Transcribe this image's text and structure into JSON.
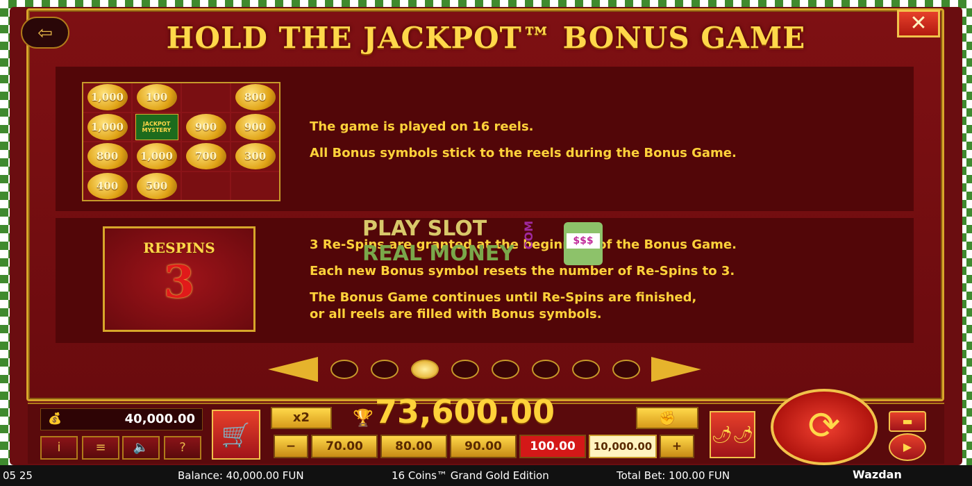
{
  "window": {
    "title": "HOLD THE JACKPOT™ BONUS GAME",
    "close_label": "✕",
    "back_label": "⇦"
  },
  "section1": {
    "grid": [
      [
        "1,000",
        "100",
        "",
        "800"
      ],
      [
        "1,000",
        "JACKPOT MYSTERY",
        "900",
        "900"
      ],
      [
        "800",
        "1,000",
        "700",
        "300"
      ],
      [
        "400",
        "500",
        "",
        ""
      ]
    ],
    "line1": "The game is played on 16 reels.",
    "line2": "All Bonus symbols stick to the reels during the Bonus Game."
  },
  "section2": {
    "respins_label": "RESPINS",
    "respins_count": "3",
    "line1": "3 Re-Spins are granted at the beginning of the Bonus Game.",
    "line2": "Each new Bonus symbol resets the number of Re-Spins to 3.",
    "line3": "The Bonus Game continues until Re-Spins are finished,",
    "line4": "or all reels are filled with Bonus symbols."
  },
  "pager": {
    "pages": 8,
    "active_index": 2
  },
  "watermark": {
    "line1": "PLAY SLOT",
    "line2": "REAL MONEY",
    "com": "COM",
    "slot_reels": "$$$"
  },
  "controls": {
    "balance_value": "40,000.00",
    "balance_icon": "money-bag-icon",
    "info_label": "i",
    "menu_label": "≡",
    "sound_label": "🔈",
    "help_label": "?",
    "shop_label": "🛒",
    "x2_label": "x2",
    "win_amount": "73,600.00",
    "autoplay_icon": "hand-icon",
    "minus_label": "−",
    "plus_label": "+",
    "bets": [
      "70.00",
      "80.00",
      "90.00",
      "100.00",
      "10,000.00"
    ],
    "selected_bet_index": 3,
    "chili_label": "🌶🌶",
    "spin_label": "⟳",
    "play_label": "▶",
    "turbo_label": "▬"
  },
  "status": {
    "time": "05 25",
    "balance": "Balance: 40,000.00 FUN",
    "game_name": "16 Coins™ Grand Gold Edition",
    "total_bet": "Total Bet: 100.00 FUN",
    "provider": "Wazdan"
  },
  "colors": {
    "accent_gold": "#ffd23a",
    "panel_red": "#7e1013",
    "selected_bet": "#d41818"
  }
}
